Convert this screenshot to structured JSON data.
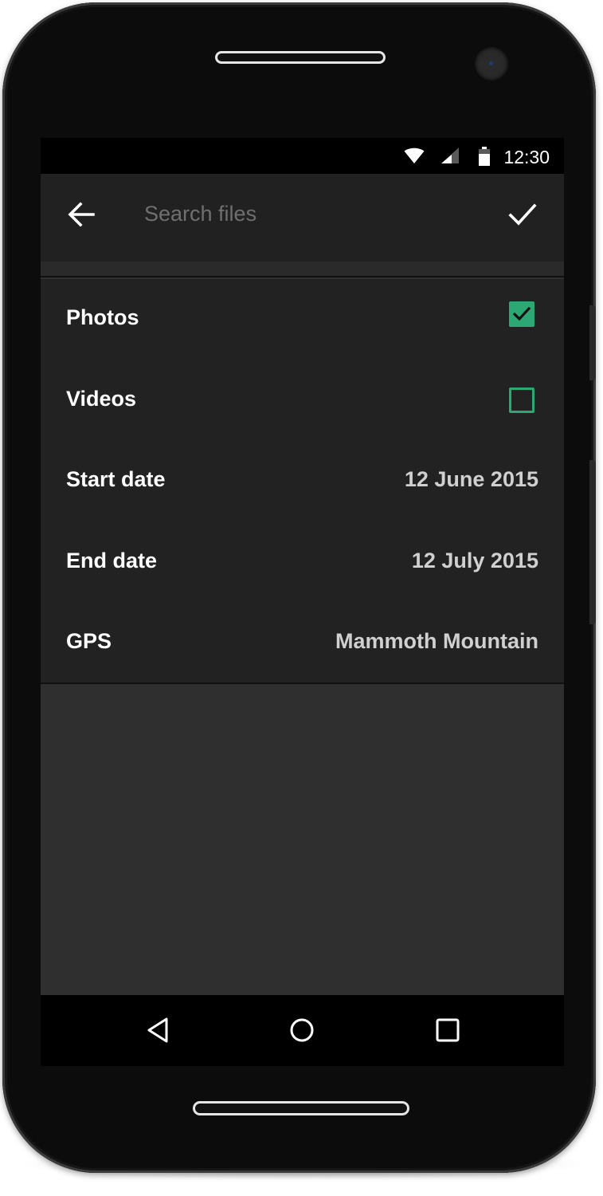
{
  "status_bar": {
    "time": "12:30",
    "icons": [
      "wifi-icon",
      "cell-signal-icon",
      "battery-icon"
    ]
  },
  "toolbar": {
    "back_icon": "arrow-back-icon",
    "search_placeholder": "Search files",
    "search_value": "",
    "confirm_icon": "checkmark-icon"
  },
  "filters": {
    "photos": {
      "label": "Photos",
      "checked": true
    },
    "videos": {
      "label": "Videos",
      "checked": false
    },
    "start_date": {
      "label": "Start date",
      "value": "12 June 2015"
    },
    "end_date": {
      "label": "End date",
      "value": "12 July 2015"
    },
    "gps": {
      "label": "GPS",
      "value": "Mammoth Mountain"
    }
  },
  "nav_bar": {
    "icons": [
      "nav-back-icon",
      "nav-home-icon",
      "nav-recents-icon"
    ]
  },
  "colors": {
    "accent": "#2ba874",
    "toolbar_bg": "#212121",
    "list_bg": "#222222",
    "screen_bg": "#2f2f2f",
    "primary_text": "#ffffff",
    "secondary_text": "#d0d0d0",
    "hint_text": "#6f6f6f"
  }
}
